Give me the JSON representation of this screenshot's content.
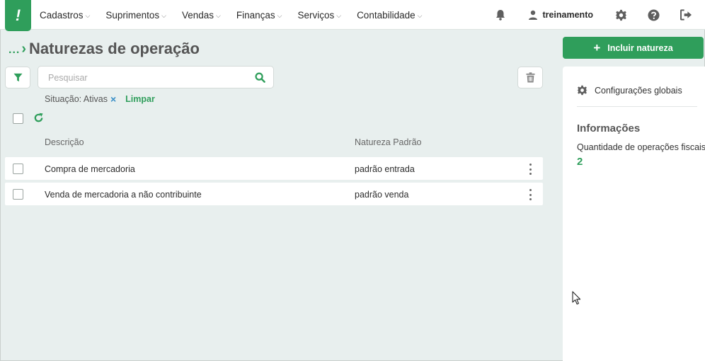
{
  "app": {
    "logo_text": "!"
  },
  "menu": {
    "items": [
      {
        "label": "Cadastros"
      },
      {
        "label": "Suprimentos"
      },
      {
        "label": "Vendas"
      },
      {
        "label": "Finanças"
      },
      {
        "label": "Serviços"
      },
      {
        "label": "Contabilidade"
      }
    ]
  },
  "header": {
    "username": "treinamento"
  },
  "page": {
    "breadcrumb_dots": "...",
    "title": "Naturezas de operação"
  },
  "search": {
    "placeholder": "Pesquisar",
    "value": ""
  },
  "filters": {
    "active_label": "Situação: Ativas",
    "remove_symbol": "×",
    "clear_label": "Limpar"
  },
  "table": {
    "columns": [
      "Descrição",
      "Natureza Padrão"
    ],
    "rows": [
      {
        "descricao": "Compra de mercadoria",
        "natureza": "padrão entrada"
      },
      {
        "descricao": "Venda de mercadoria a não contribuinte",
        "natureza": "padrão venda"
      }
    ]
  },
  "sidebar": {
    "include_button": "Incluir natureza",
    "global_config": "Configurações globais",
    "info_title": "Informações",
    "info_label": "Quantidade de operações fiscais",
    "info_value": "2"
  },
  "colors": {
    "brand": "#2f9e5b",
    "background": "#e8efee",
    "accent_blue": "#3a8fc7"
  },
  "icons": {
    "bell": "bell-icon",
    "user": "user-icon",
    "settings": "gear-icon",
    "help": "help-icon",
    "logout": "logout-icon",
    "filter": "filter-icon",
    "search": "search-icon",
    "trash": "trash-icon",
    "refresh": "refresh-icon",
    "row_menu": "kebab-icon"
  }
}
